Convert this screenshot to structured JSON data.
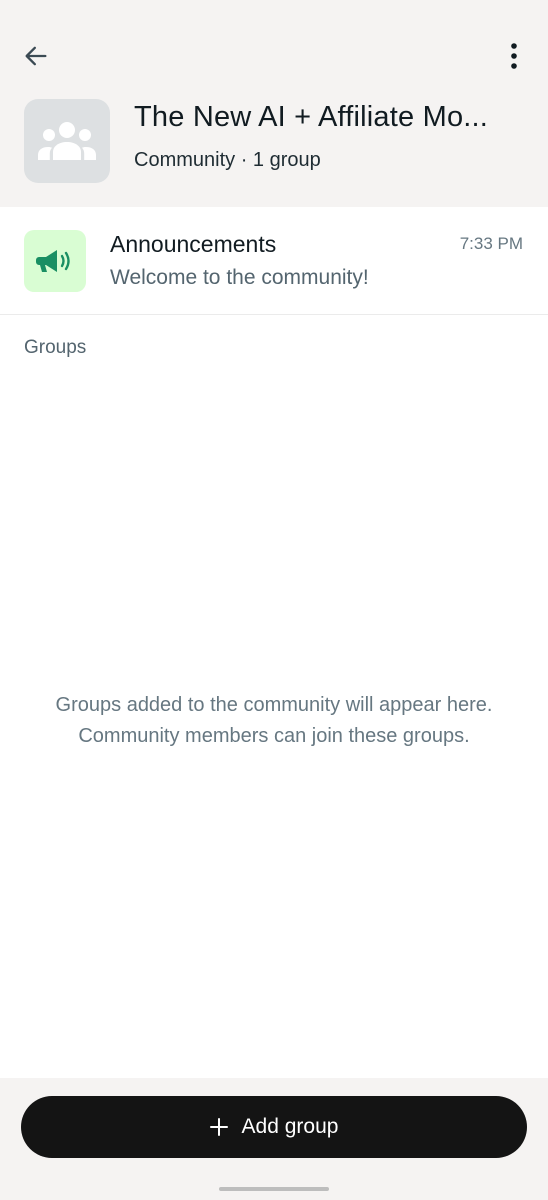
{
  "header": {
    "title": "The New AI + Affiliate Mo...",
    "subtitle": "Community · 1 group"
  },
  "announcements": {
    "title": "Announcements",
    "time": "7:33 PM",
    "preview": "Welcome to the community!"
  },
  "groups": {
    "label": "Groups",
    "empty_line1": "Groups added to the community will appear here.",
    "empty_line2": "Community members can join these groups."
  },
  "footer": {
    "add_group_label": "Add group"
  },
  "icons": {
    "back": "arrow-left-icon",
    "menu": "more-vertical-icon",
    "community": "community-people-icon",
    "announcements": "megaphone-icon",
    "add": "plus-icon"
  },
  "colors": {
    "header_bg": "#f5f3f2",
    "announcement_icon_bg": "#d9fdd3",
    "announcement_icon_fg": "#1a8f63",
    "button_bg": "#141414"
  }
}
